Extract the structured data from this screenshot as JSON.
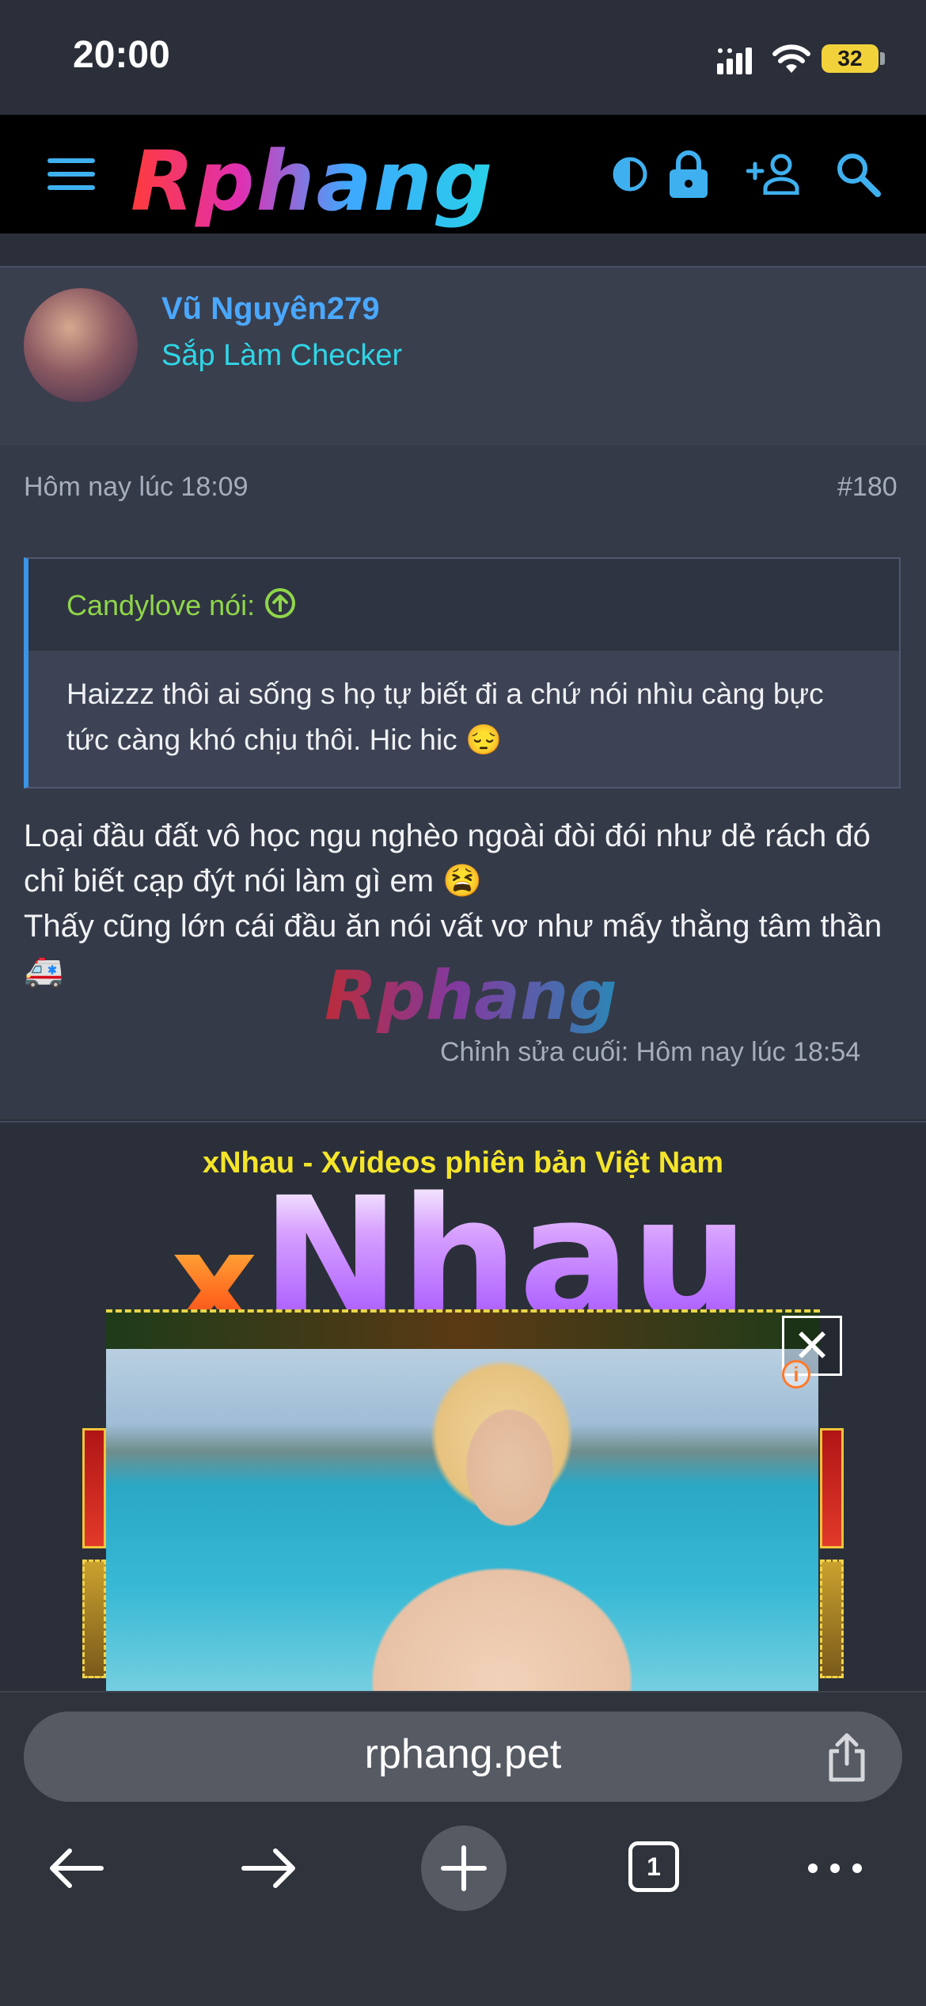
{
  "status_bar": {
    "time": "20:00",
    "battery_level": "32"
  },
  "header": {
    "logo": "Rphang",
    "icons": [
      "menu-icon",
      "contrast-icon",
      "lock-icon",
      "add-user-icon",
      "search-icon"
    ]
  },
  "post": {
    "author": {
      "name": "Vũ Nguyên279",
      "title": "Sắp Làm Checker"
    },
    "date": "Hôm nay lúc 18:09",
    "number": "#180",
    "quote": {
      "author": "Candylove nói:",
      "text": "Haizzz thôi ai sống s họ tự biết đi a chứ nói nhìu càng bực tức càng khó chịu thôi. Hic hic 😔"
    },
    "message_line1": "Loại đầu đất vô học ngu nghèo ngoài đòi đói như dẻ rách đó chỉ biết cạp đýt nói làm gì em 😫",
    "message_line2": "Thấy cũng lớn cái đầu ăn nói vất vơ như mấy thằng tâm thần 🚑",
    "watermark": "Rphang",
    "edit_note": "Chỉnh sửa cuối: Hôm nay lúc 18:54"
  },
  "ad": {
    "title": "xNhau - Xvideos phiên bản Việt Nam",
    "logo": "xNhau",
    "info_label": "i",
    "close_label": "✕"
  },
  "browser": {
    "url": "rphang.pet",
    "tab_count": "1"
  },
  "colors": {
    "accent_blue": "#4aa8ff",
    "title_cyan": "#2fd6e6",
    "quote_green": "#8fd64a",
    "ad_title_yellow": "#f5e52a"
  }
}
